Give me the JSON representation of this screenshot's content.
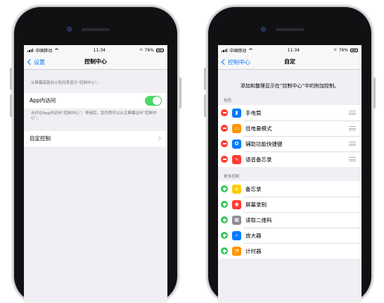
{
  "status_bar": {
    "carrier": "中国移动",
    "time": "11:34",
    "battery": "76%"
  },
  "left_screen": {
    "nav": {
      "back_label": "设置",
      "title": "控制中心"
    },
    "top_caption": "从屏幕底部向上轻扫来显示“控制中心”。",
    "app_access": {
      "label": "App内访问",
      "enabled": true,
      "caption": "允许在App内访问“控制中心”。停用后，您仍然可以从主屏幕访问“控制中心”。"
    },
    "customize_label": "自定控制"
  },
  "right_screen": {
    "nav": {
      "back_label": "控制中心",
      "title": "自定"
    },
    "intro": "添加和整理显示在“控制中心”中的附加控制。",
    "included_header": "包括",
    "included": [
      {
        "label": "手电筒",
        "icon": "flashlight-icon",
        "color": "#007aff"
      },
      {
        "label": "低电量模式",
        "icon": "battery-icon",
        "color": "#ff9500"
      },
      {
        "label": "辅助功能快捷键",
        "icon": "accessibility-icon",
        "color": "#007aff"
      },
      {
        "label": "语音备忘录",
        "icon": "voice-memo-icon",
        "color": "#ff3b30"
      }
    ],
    "more_header": "更多控制",
    "more": [
      {
        "label": "备忘录",
        "icon": "notes-icon",
        "color": "#ffcc00"
      },
      {
        "label": "屏幕录制",
        "icon": "screen-record-icon",
        "color": "#ff3b30"
      },
      {
        "label": "读取二维码",
        "icon": "qr-code-icon",
        "color": "#8e8e93"
      },
      {
        "label": "放大器",
        "icon": "magnifier-icon",
        "color": "#007aff"
      },
      {
        "label": "计时器",
        "icon": "timer-icon",
        "color": "#ff9500"
      }
    ]
  },
  "colors": {
    "ios_blue": "#007aff",
    "toggle_green": "#4cd964",
    "delete_red": "#ff3b30",
    "add_green": "#34c759"
  }
}
